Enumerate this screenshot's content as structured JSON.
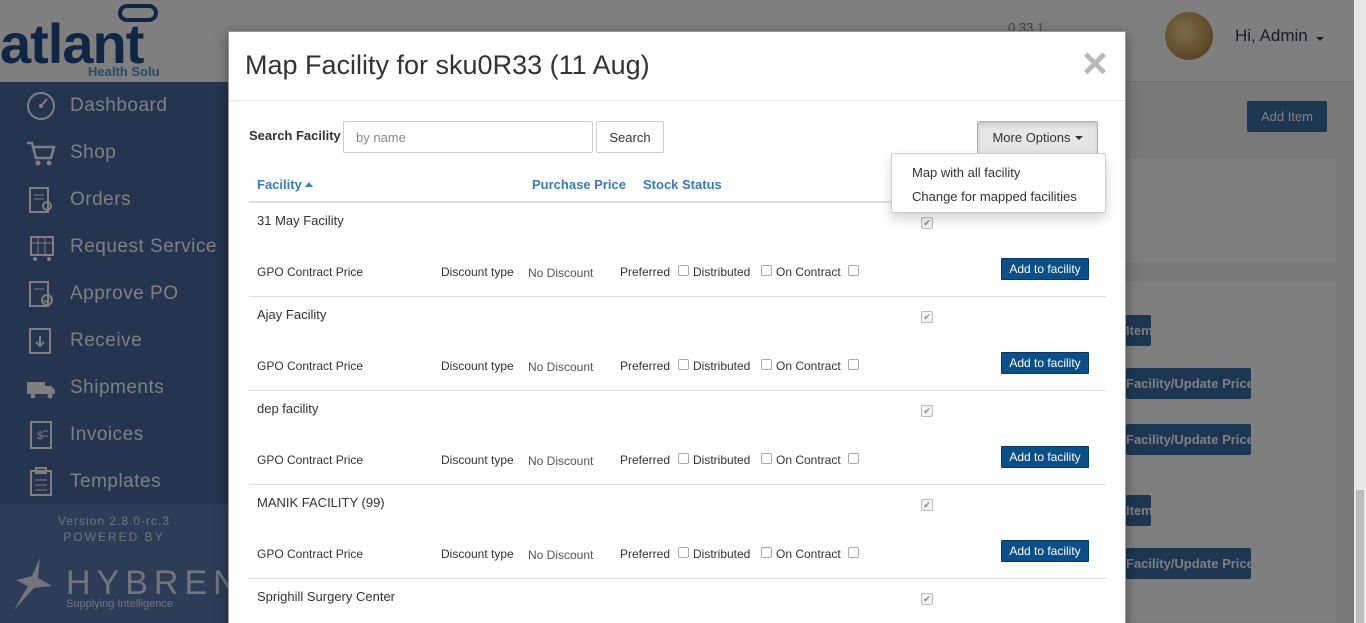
{
  "sidebar": {
    "logo_text": "atlant",
    "logo_sub": "Health Solu",
    "items": [
      {
        "label": "Dashboard",
        "icon": "speedometer-icon"
      },
      {
        "label": "Shop",
        "icon": "cart-icon"
      },
      {
        "label": "Orders",
        "icon": "clipboard-search-icon"
      },
      {
        "label": "Request Service",
        "icon": "cart-calendar-icon"
      },
      {
        "label": "Approve PO",
        "icon": "clipboard-check-icon"
      },
      {
        "label": "Receive",
        "icon": "clipboard-download-icon"
      },
      {
        "label": "Shipments",
        "icon": "truck-icon"
      },
      {
        "label": "Invoices",
        "icon": "invoice-icon"
      },
      {
        "label": "Templates",
        "icon": "template-icon"
      }
    ],
    "version": "Version 2.8.0-rc.3",
    "powered_by": "POWERED BY",
    "brand": "HYBRENT",
    "tagline": "Supplying Intelligence"
  },
  "topbar": {
    "counters": "0   33   1",
    "user": "Hi, Admin",
    "add_item": "Add Item"
  },
  "background_buttons": [
    "Item",
    "Facility/Update Price",
    "Facility/Update Price",
    "Item",
    "Facility/Update Price"
  ],
  "modal": {
    "title": "Map Facility for sku0R33 (11 Aug)",
    "close": "×",
    "search_label": "Search Facility",
    "search_placeholder": "by name",
    "search_button": "Search",
    "more_options": "More Options",
    "dropdown": [
      "Map with all facility",
      "Change for mapped facilities"
    ],
    "columns": {
      "facility": "Facility",
      "purchase_price": "Purchase Price",
      "stock_status": "Stock Status"
    },
    "row_labels": {
      "gpo": "GPO Contract Price",
      "discount_type": "Discount type",
      "preferred": "Preferred",
      "distributed": "Distributed",
      "on_contract": "On Contract",
      "add_button": "Add to facility"
    },
    "facilities": [
      {
        "name": "31 May Facility",
        "discount": "No Discount",
        "stock_checked": true
      },
      {
        "name": "Ajay Facility",
        "discount": "No Discount",
        "stock_checked": true
      },
      {
        "name": "dep facility",
        "discount": "No Discount",
        "stock_checked": true
      },
      {
        "name": "MANIK FACILITY (99)",
        "discount": "No Discount",
        "stock_checked": true
      },
      {
        "name": "Sprighill Surgery Center",
        "discount": "",
        "stock_checked": true
      }
    ]
  }
}
